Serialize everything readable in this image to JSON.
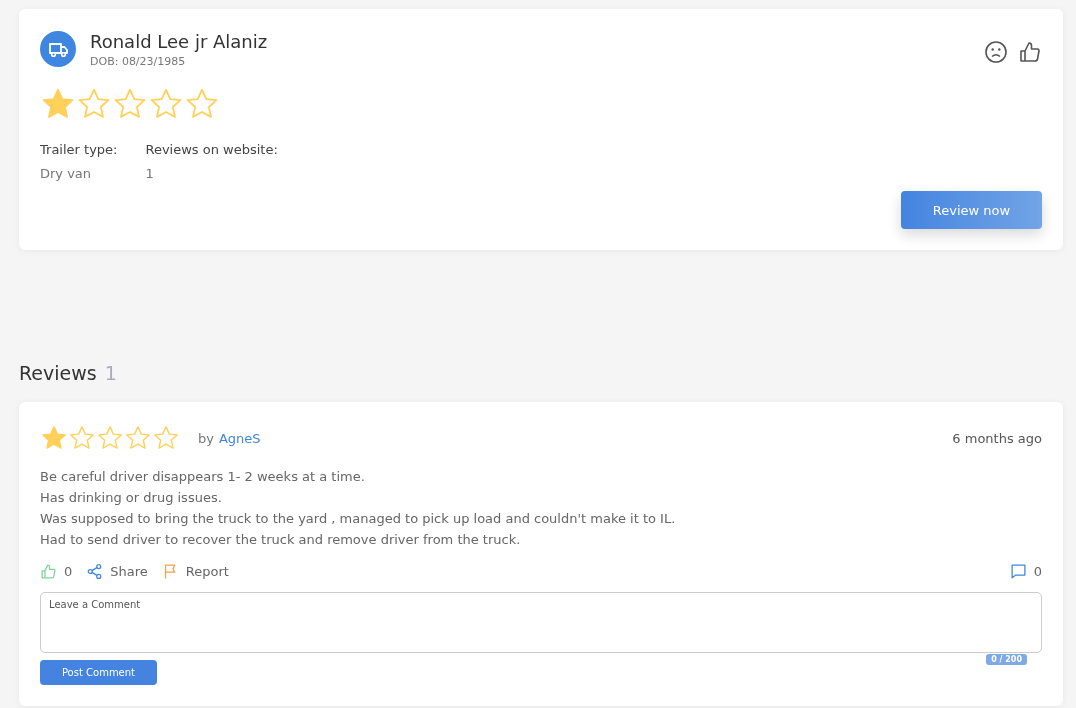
{
  "driver": {
    "name": "Ronald Lee jr Alaniz",
    "dob": "DOB: 08/23/1985",
    "stars": 1,
    "fields": [
      {
        "label": "Trailer type:",
        "value": "Dry van"
      },
      {
        "label": "Reviews on website:",
        "value": "1"
      }
    ],
    "button": "Review now"
  },
  "reviews_heading": {
    "title": "Reviews",
    "count": "1"
  },
  "reviews": [
    {
      "stars": 1,
      "by": "by",
      "author": "AgneS",
      "time": "6 months ago",
      "lines": [
        "Be careful driver disappears 1- 2 weeks at a time.",
        "Has drinking or drug issues.",
        "Was supposed to bring the truck to the yard , managed to pick up load and couldn't make it to IL.",
        "Had to send driver to recover the truck and remove driver from the truck."
      ],
      "likes": "0",
      "share": "Share",
      "report": "Report",
      "comments": "0",
      "comment_placeholder": "Leave a Comment",
      "counter": "0 / 200",
      "post_button": "Post Comment"
    }
  ]
}
